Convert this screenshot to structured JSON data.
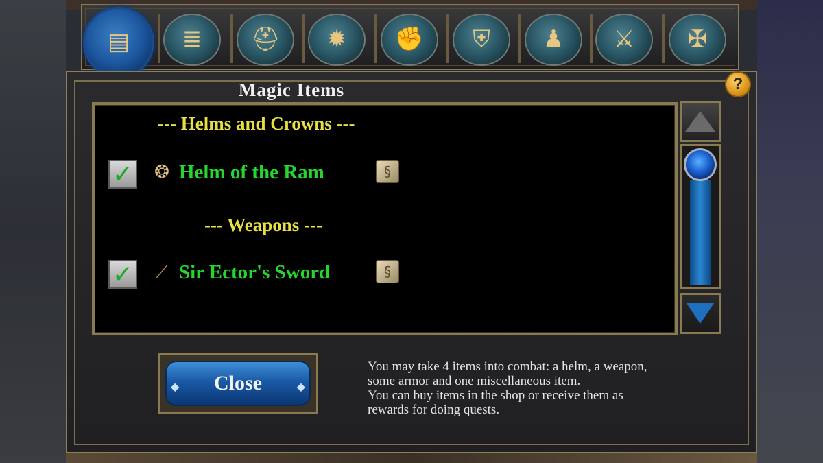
{
  "tabs": [
    {
      "name": "treasure-chest-icon",
      "glyph": "▤",
      "active": true
    },
    {
      "name": "scroll-icon",
      "glyph": "≣",
      "active": false
    },
    {
      "name": "knight-helmet-icon",
      "glyph": "⛑",
      "active": false
    },
    {
      "name": "magic-burst-icon",
      "glyph": "✹",
      "active": false
    },
    {
      "name": "gauntlet-icon",
      "glyph": "✊",
      "active": false
    },
    {
      "name": "red-shield-icon",
      "glyph": "⛨",
      "active": false
    },
    {
      "name": "blue-figure-icon",
      "glyph": "♟",
      "active": false
    },
    {
      "name": "flail-icon",
      "glyph": "⚔",
      "active": false
    },
    {
      "name": "cross-icon",
      "glyph": "✠",
      "active": false
    }
  ],
  "panel": {
    "title": "Magic Items",
    "help_label": "?"
  },
  "list": {
    "categories": [
      {
        "label": "--- Helms and Crowns ---"
      },
      {
        "label": "--- Weapons ---"
      }
    ],
    "items": [
      {
        "name": "Helm of the Ram",
        "checked": true,
        "icon": "ram-helm-icon"
      },
      {
        "name": "Sir Ector's Sword",
        "checked": true,
        "icon": "sword-icon"
      }
    ]
  },
  "close_button": {
    "label": "Close"
  },
  "info_text": [
    "You may take 4 items into combat: a helm, a weapon,",
    "some armor and one miscellaneous item.",
    "You can buy items in the shop or receive them as",
    "rewards for doing quests."
  ],
  "colors": {
    "category": "#e8e040",
    "item_name": "#26d62e",
    "accent_blue": "#1a5aa6",
    "frame_gold": "#8a7a52"
  }
}
